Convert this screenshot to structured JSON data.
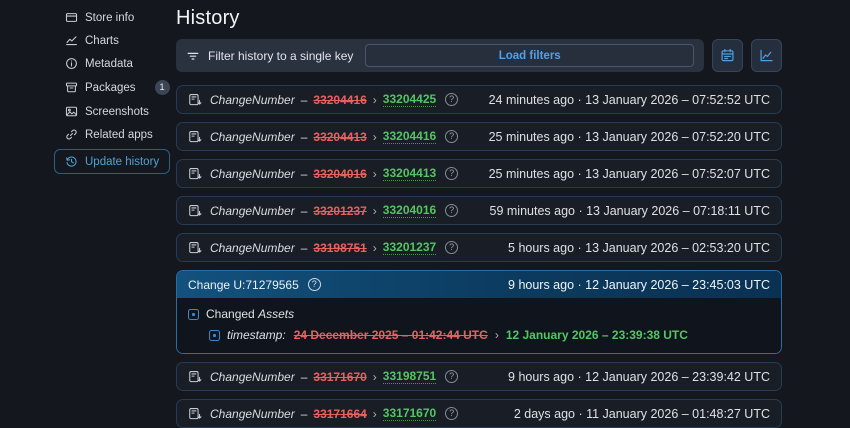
{
  "header": {
    "title": "History"
  },
  "sidebar": {
    "items": [
      {
        "label": "Store info",
        "icon": "store-info-icon",
        "active": false
      },
      {
        "label": "Charts",
        "icon": "charts-icon",
        "active": false
      },
      {
        "label": "Metadata",
        "icon": "metadata-icon",
        "active": false
      },
      {
        "label": "Packages",
        "icon": "packages-icon",
        "active": false,
        "badge": "1"
      },
      {
        "label": "Screenshots",
        "icon": "screenshots-icon",
        "active": false
      },
      {
        "label": "Related apps",
        "icon": "related-apps-icon",
        "active": false
      },
      {
        "label": "Update history",
        "icon": "update-history-icon",
        "active": true
      }
    ]
  },
  "filter": {
    "label": "Filter history to a single key",
    "load_button": "Load filters",
    "icons": [
      "filter-icon",
      "calendar-icon",
      "chart-icon"
    ]
  },
  "rows": [
    {
      "type": "change",
      "label": "ChangeNumber",
      "dash": "–",
      "sep": "›",
      "old": "33204416",
      "new": "33204425",
      "help": "?",
      "time": "24 minutes ago · 13 January 2026 – 07:52:52 UTC"
    },
    {
      "type": "change",
      "label": "ChangeNumber",
      "dash": "–",
      "sep": "›",
      "old": "33204413",
      "new": "33204416",
      "help": "?",
      "time": "25 minutes ago · 13 January 2026 – 07:52:20 UTC"
    },
    {
      "type": "change",
      "label": "ChangeNumber",
      "dash": "–",
      "sep": "›",
      "old": "33204016",
      "new": "33204413",
      "help": "?",
      "time": "25 minutes ago · 13 January 2026 – 07:52:07 UTC"
    },
    {
      "type": "change",
      "label": "ChangeNumber",
      "dash": "–",
      "sep": "›",
      "old": "33201237",
      "new": "33204016",
      "help": "?",
      "time": "59 minutes ago · 13 January 2026 – 07:18:11 UTC"
    },
    {
      "type": "change",
      "label": "ChangeNumber",
      "dash": "–",
      "sep": "›",
      "old": "33198751",
      "new": "33201237",
      "help": "?",
      "time": "5 hours ago · 13 January 2026 – 02:53:20 UTC"
    },
    {
      "type": "expanded",
      "title": "Change U:71279565",
      "help": "?",
      "time": "9 hours ago · 12 January 2026 – 23:45:03 UTC",
      "group_label": "Changed",
      "group_target": "Assets",
      "key": "timestamp:",
      "sep": "›",
      "old": "24 December 2025 – 01:42:44 UTC",
      "new": "12 January 2026 – 23:39:38 UTC"
    },
    {
      "type": "change",
      "label": "ChangeNumber",
      "dash": "–",
      "sep": "›",
      "old": "33171670",
      "new": "33198751",
      "help": "?",
      "time": "9 hours ago · 12 January 2026 – 23:39:42 UTC"
    },
    {
      "type": "change",
      "label": "ChangeNumber",
      "dash": "–",
      "sep": "›",
      "old": "33171664",
      "new": "33171670",
      "help": "?",
      "time": "2 days ago · 11 January 2026 – 01:48:27 UTC"
    }
  ],
  "colors": {
    "background": "#14171e",
    "row_background": "#181d26",
    "accent_blue": "#4ba3f0",
    "active_nav_blue": "#4da4d4",
    "removed_red": "#e8615f",
    "added_green": "#53c661",
    "highlight_header_left": "#12527e",
    "highlight_header_right": "#0a3152"
  }
}
